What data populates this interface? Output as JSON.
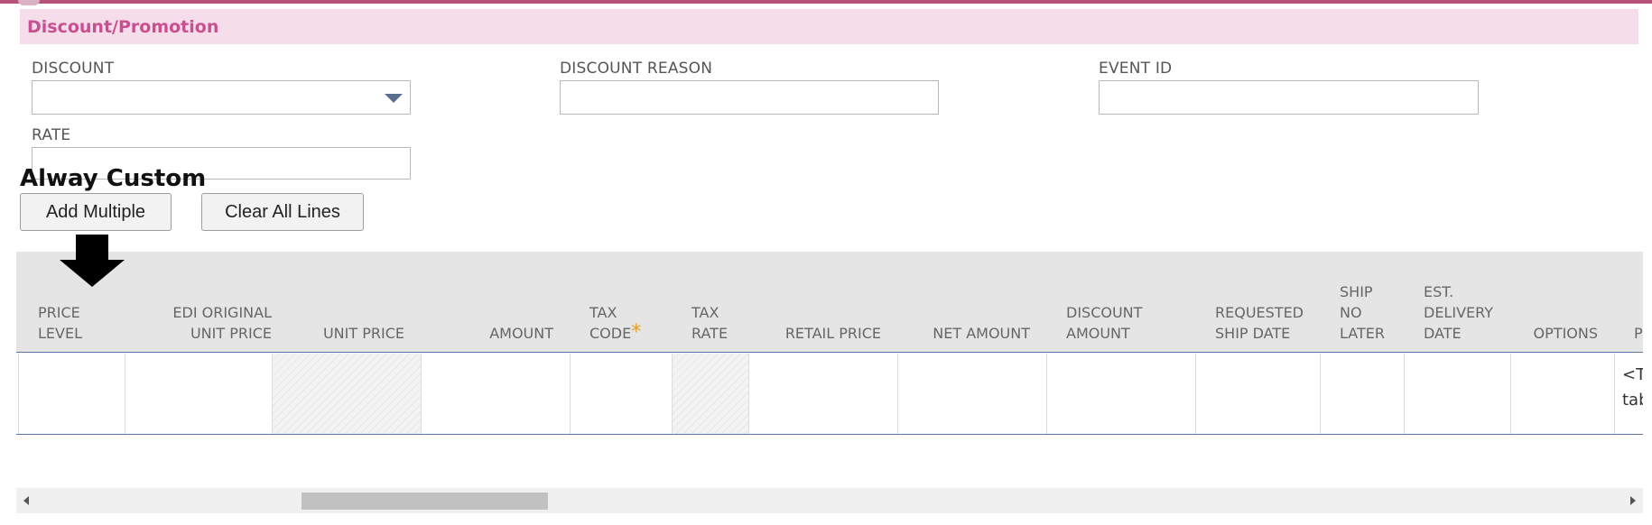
{
  "section": {
    "title": "Discount/Promotion"
  },
  "fields": {
    "discount": {
      "label": "DISCOUNT",
      "value": ""
    },
    "discount_reason": {
      "label": "DISCOUNT REASON",
      "value": ""
    },
    "event_id": {
      "label": "EVENT ID",
      "value": ""
    },
    "rate": {
      "label": "RATE",
      "value": ""
    }
  },
  "custom_heading": "Alway Custom",
  "buttons": {
    "add_multiple": "Add Multiple",
    "clear_all_lines": "Clear All Lines"
  },
  "table": {
    "columns": [
      {
        "line1": "PRICE",
        "line2": "LEVEL",
        "line3": ""
      },
      {
        "line1": "EDI ORIGINAL",
        "line2": "UNIT PRICE",
        "line3": ""
      },
      {
        "line1": "UNIT PRICE",
        "line2": "",
        "line3": ""
      },
      {
        "line1": "AMOUNT",
        "line2": "",
        "line3": ""
      },
      {
        "line1": "TAX",
        "line2": "CODE",
        "line3": "",
        "required": "*"
      },
      {
        "line1": "TAX",
        "line2": "RATE",
        "line3": ""
      },
      {
        "line1": "RETAIL PRICE",
        "line2": "",
        "line3": ""
      },
      {
        "line1": "NET AMOUNT",
        "line2": "",
        "line3": ""
      },
      {
        "line1": "DISCOUNT",
        "line2": "AMOUNT",
        "line3": ""
      },
      {
        "line1": "REQUESTED",
        "line2": "SHIP DATE",
        "line3": ""
      },
      {
        "line1": "SHIP",
        "line2": "NO",
        "line3": "LATER"
      },
      {
        "line1": "EST.",
        "line2": "DELIVERY",
        "line3": "DATE"
      },
      {
        "line1": "OPTIONS",
        "line2": "",
        "line3": ""
      },
      {
        "line1": "P",
        "line2": "",
        "line3": ""
      }
    ],
    "row_last_cell_text": "<Ty\ntab"
  },
  "colors": {
    "accent": "#c94f91",
    "header_bg": "#f5dde9",
    "grid_head_bg": "#e5e5e5"
  },
  "icons": {
    "dropdown": "chevron-down-icon",
    "arrow": "down-arrow-icon"
  },
  "scroll": {
    "position_fraction": 0.17
  }
}
